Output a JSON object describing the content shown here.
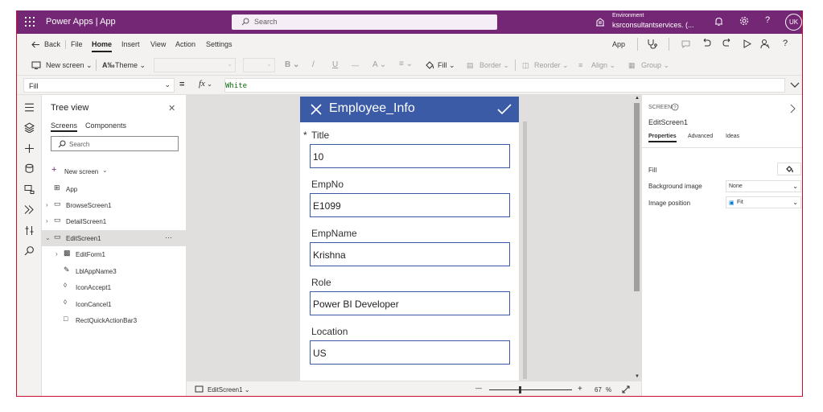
{
  "colors": {
    "topbar": "#742774",
    "header": "#3b5ba7",
    "border": "#c8102e"
  },
  "topbar": {
    "title": "Power Apps  |  App",
    "search_placeholder": "Search",
    "environment_label": "Environment",
    "environment_value": "ksrconsultantservices. (...",
    "user_initials": "UK",
    "help_icon": "?"
  },
  "menubar": {
    "back": "Back",
    "file": "File",
    "home": "Home",
    "insert": "Insert",
    "view": "View",
    "action": "Action",
    "settings": "Settings",
    "app": "App",
    "help": "?"
  },
  "toolbar": {
    "new_screen": "New screen",
    "theme": "Theme",
    "bold": "B",
    "italic": "/",
    "underline": "U",
    "strike": "—",
    "font_size": "A",
    "align_text": "≡",
    "fill": "Fill",
    "border": "Border",
    "reorder": "Reorder",
    "align": "Align",
    "group": "Group"
  },
  "formulabar": {
    "property": "Fill",
    "equals": "=",
    "fx": "fx",
    "value": "White"
  },
  "tree": {
    "title": "Tree view",
    "tabs": [
      "Screens",
      "Components"
    ],
    "search_placeholder": "Search",
    "new_screen": "New screen",
    "items": [
      {
        "label": "App"
      },
      {
        "label": "BrowseScreen1"
      },
      {
        "label": "DetailScreen1"
      },
      {
        "label": "EditScreen1",
        "more": "···"
      },
      {
        "label": "EditForm1"
      },
      {
        "label": "LblAppName3"
      },
      {
        "label": "IconAccept1"
      },
      {
        "label": "IconCancel1"
      },
      {
        "label": "RectQuickActionBar3"
      }
    ]
  },
  "screen": {
    "header_title": "Employee_Info",
    "required_mark": "*",
    "fields": [
      {
        "label": "Title",
        "value": "10"
      },
      {
        "label": "EmpNo",
        "value": "E1099"
      },
      {
        "label": "EmpName",
        "value": "Krishna"
      },
      {
        "label": "Role",
        "value": "Power BI Developer"
      },
      {
        "label": "Location",
        "value": "US"
      }
    ]
  },
  "statusbar": {
    "screen": "EditScreen1",
    "minus": "—",
    "plus": "+",
    "zoom": "67",
    "zoom_unit": "%"
  },
  "rpanel": {
    "type": "SCREEN",
    "name": "EditScreen1",
    "tabs": [
      "Properties",
      "Advanced",
      "Ideas"
    ],
    "fill_label": "Fill",
    "bg_label": "Background image",
    "bg_value": "None",
    "pos_label": "Image position",
    "pos_value": "Fit"
  }
}
